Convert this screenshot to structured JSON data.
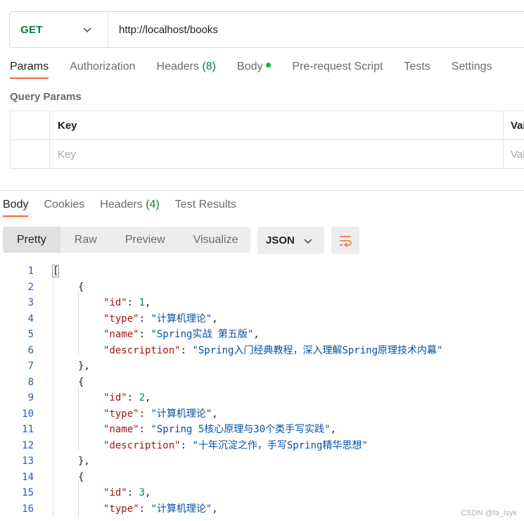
{
  "request": {
    "method": "GET",
    "url": "http://localhost/books"
  },
  "request_tabs": {
    "params": "Params",
    "authorization": "Authorization",
    "headers": "Headers",
    "headers_count": "(8)",
    "body": "Body",
    "pre_request": "Pre-request Script",
    "tests": "Tests",
    "settings": "Settings"
  },
  "query_params": {
    "title": "Query Params",
    "key_header": "Key",
    "value_header": "Value",
    "key_placeholder": "Key",
    "value_placeholder": "Value"
  },
  "response_tabs": {
    "body": "Body",
    "cookies": "Cookies",
    "headers": "Headers",
    "headers_count": "(4)",
    "test_results": "Test Results"
  },
  "view_modes": {
    "pretty": "Pretty",
    "raw": "Raw",
    "preview": "Preview",
    "visualize": "Visualize"
  },
  "format": "JSON",
  "colors": {
    "method": "#0b7a3e",
    "active_tab_underline": "#f26b3a",
    "wrap_icon": "#f26b3a",
    "json_key": "#a31515",
    "json_string": "#0451a5",
    "json_number": "#098658",
    "line_number": "#2a5bb5"
  },
  "code_lines": [
    {
      "n": "1",
      "indent": 0,
      "parts": [
        [
          "p",
          "["
        ]
      ]
    },
    {
      "n": "2",
      "indent": 1,
      "parts": [
        [
          "p",
          "{"
        ]
      ]
    },
    {
      "n": "3",
      "indent": 2,
      "parts": [
        [
          "k",
          "\"id\""
        ],
        [
          "p",
          ": "
        ],
        [
          "n",
          "1"
        ],
        [
          "p",
          ","
        ]
      ]
    },
    {
      "n": "4",
      "indent": 2,
      "parts": [
        [
          "k",
          "\"type\""
        ],
        [
          "p",
          ": "
        ],
        [
          "s",
          "\"计算机理论\""
        ],
        [
          "p",
          ","
        ]
      ]
    },
    {
      "n": "5",
      "indent": 2,
      "parts": [
        [
          "k",
          "\"name\""
        ],
        [
          "p",
          ": "
        ],
        [
          "s",
          "\"Spring实战 第五版\""
        ],
        [
          "p",
          ","
        ]
      ]
    },
    {
      "n": "6",
      "indent": 2,
      "parts": [
        [
          "k",
          "\"description\""
        ],
        [
          "p",
          ": "
        ],
        [
          "s",
          "\"Spring入门经典教程，深入理解Spring原理技术内幕\""
        ]
      ]
    },
    {
      "n": "7",
      "indent": 1,
      "parts": [
        [
          "p",
          "},"
        ]
      ]
    },
    {
      "n": "8",
      "indent": 1,
      "parts": [
        [
          "p",
          "{"
        ]
      ]
    },
    {
      "n": "9",
      "indent": 2,
      "parts": [
        [
          "k",
          "\"id\""
        ],
        [
          "p",
          ": "
        ],
        [
          "n",
          "2"
        ],
        [
          "p",
          ","
        ]
      ]
    },
    {
      "n": "10",
      "indent": 2,
      "parts": [
        [
          "k",
          "\"type\""
        ],
        [
          "p",
          ": "
        ],
        [
          "s",
          "\"计算机理论\""
        ],
        [
          "p",
          ","
        ]
      ]
    },
    {
      "n": "11",
      "indent": 2,
      "parts": [
        [
          "k",
          "\"name\""
        ],
        [
          "p",
          ": "
        ],
        [
          "s",
          "\"Spring 5核心原理与30个类手写实践\""
        ],
        [
          "p",
          ","
        ]
      ]
    },
    {
      "n": "12",
      "indent": 2,
      "parts": [
        [
          "k",
          "\"description\""
        ],
        [
          "p",
          ": "
        ],
        [
          "s",
          "\"十年沉淀之作，手写Spring精华思想\""
        ]
      ]
    },
    {
      "n": "13",
      "indent": 1,
      "parts": [
        [
          "p",
          "},"
        ]
      ]
    },
    {
      "n": "14",
      "indent": 1,
      "parts": [
        [
          "p",
          "{"
        ]
      ]
    },
    {
      "n": "15",
      "indent": 2,
      "parts": [
        [
          "k",
          "\"id\""
        ],
        [
          "p",
          ": "
        ],
        [
          "n",
          "3"
        ],
        [
          "p",
          ","
        ]
      ]
    },
    {
      "n": "16",
      "indent": 2,
      "parts": [
        [
          "k",
          "\"type\""
        ],
        [
          "p",
          ": "
        ],
        [
          "s",
          "\"计算机理论\""
        ],
        [
          "p",
          ","
        ]
      ]
    }
  ],
  "watermark": "CSDN @fa_lsyk"
}
